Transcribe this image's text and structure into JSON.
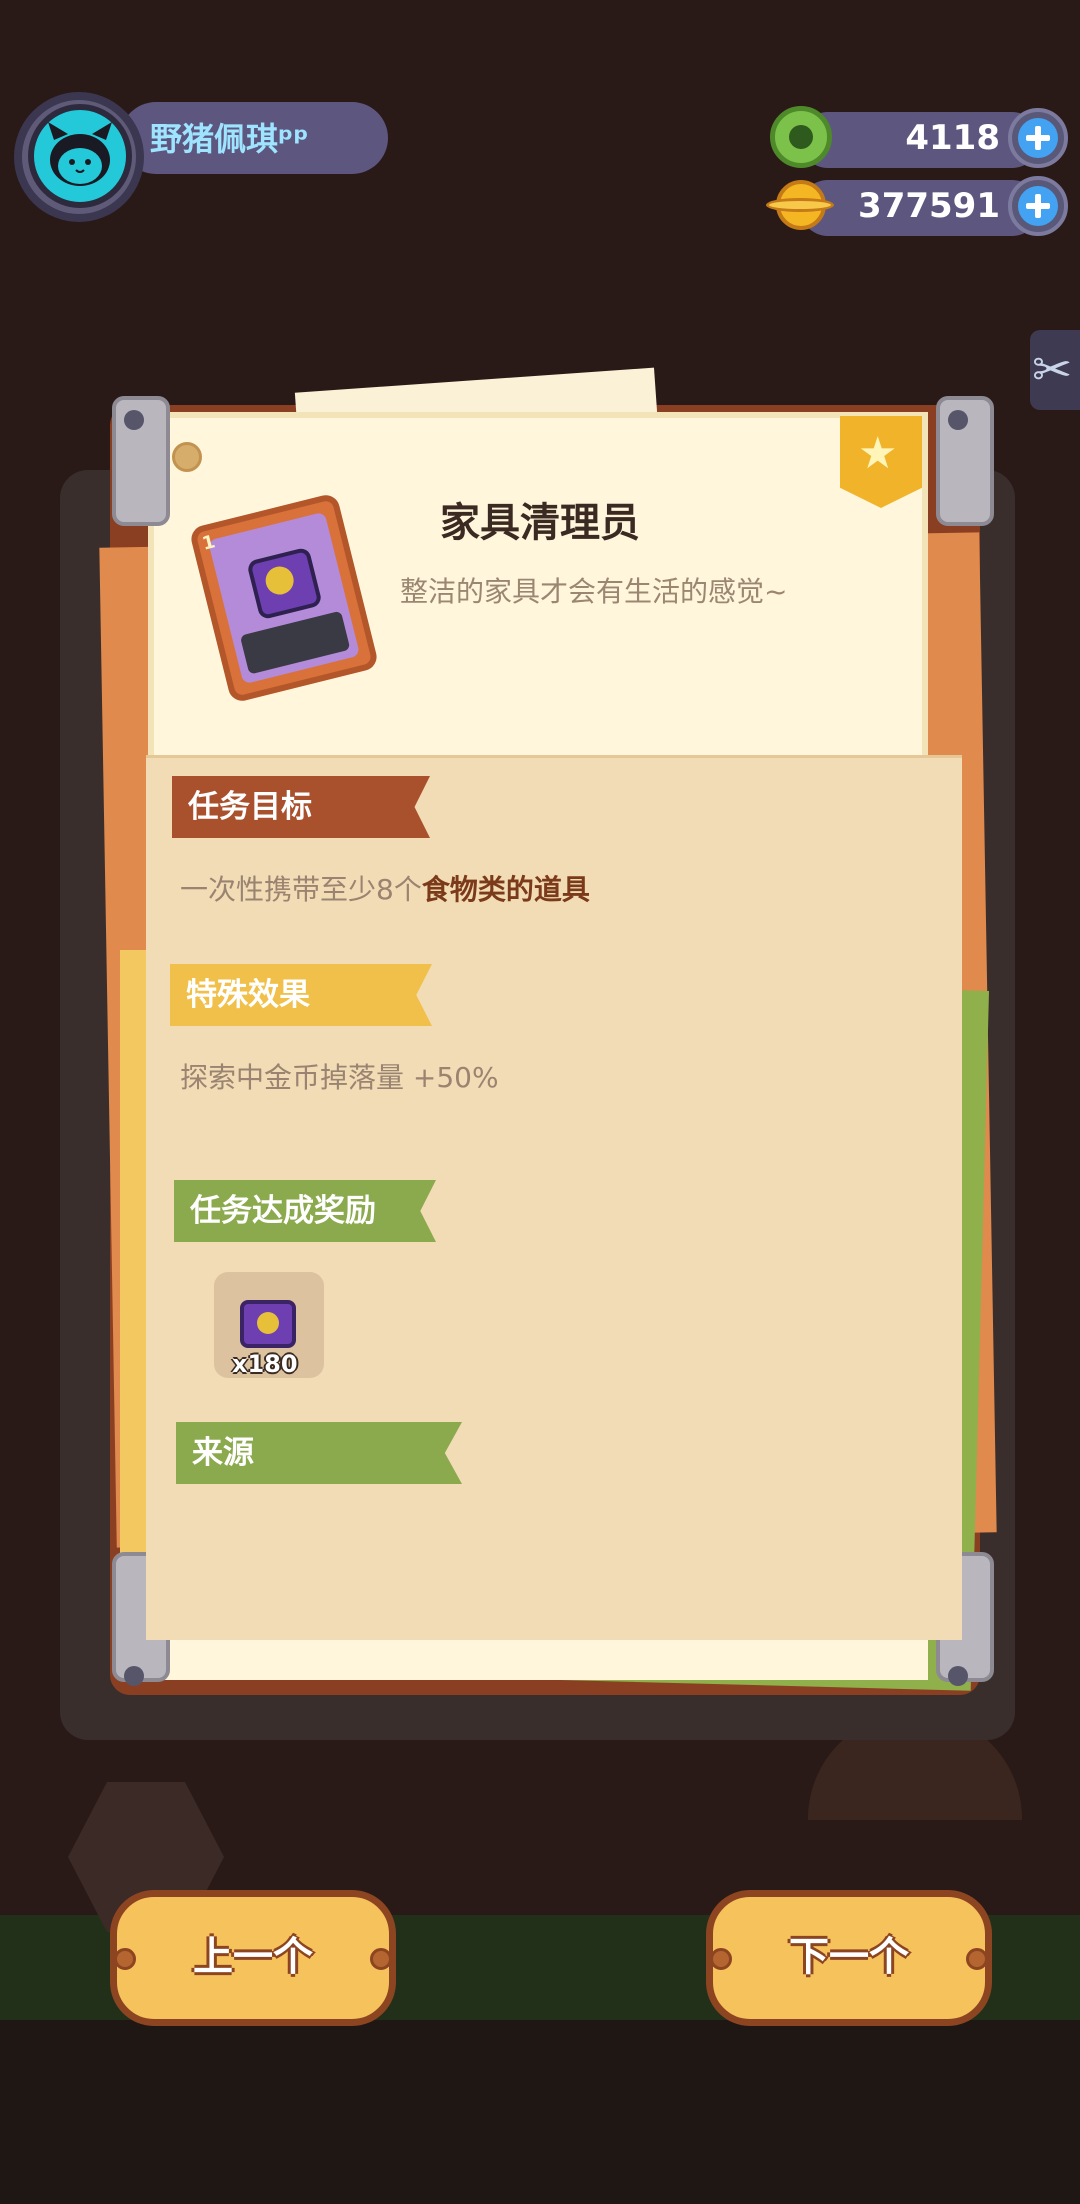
{
  "player": {
    "name": "野猪佩琪ᵖᵖ",
    "avatar_icon": "cat-face-icon"
  },
  "currencies": [
    {
      "icon": "green-gem-coin-icon",
      "amount": "4118",
      "add_icon": "plus-icon"
    },
    {
      "icon": "gold-planet-coin-icon",
      "amount": "377591",
      "add_icon": "plus-icon"
    }
  ],
  "side_tab": {
    "icon": "scissors-icon"
  },
  "card": {
    "title": "家具清理员",
    "subtitle": "整洁的家具才会有生活的感觉~",
    "item_level": "1",
    "item_icon": "tv-furniture-card-icon",
    "badge_icon": "star-icon"
  },
  "sections": {
    "goal": {
      "label": "任务目标",
      "text_prefix": "一次性携带至少8个",
      "text_highlight": "食物类的道具"
    },
    "effect": {
      "label": "特殊效果",
      "text": "探索中金币掉落量 +50%"
    },
    "reward": {
      "label": "任务达成奖励",
      "item_icon": "tv-ticket-icon",
      "quantity": "x180"
    },
    "source": {
      "label": "来源"
    }
  },
  "nav": {
    "prev_label": "上一个",
    "next_label": "下一个"
  },
  "colors": {
    "background": "#2a1a17",
    "board": "#8a3f22",
    "paper": "#fff6dc",
    "panel": "#f2dcb5",
    "ribbon_goal": "#a9502c",
    "ribbon_effect": "#f0c04a",
    "ribbon_reward": "#8ba94d",
    "nav_button": "#f6c25b"
  }
}
